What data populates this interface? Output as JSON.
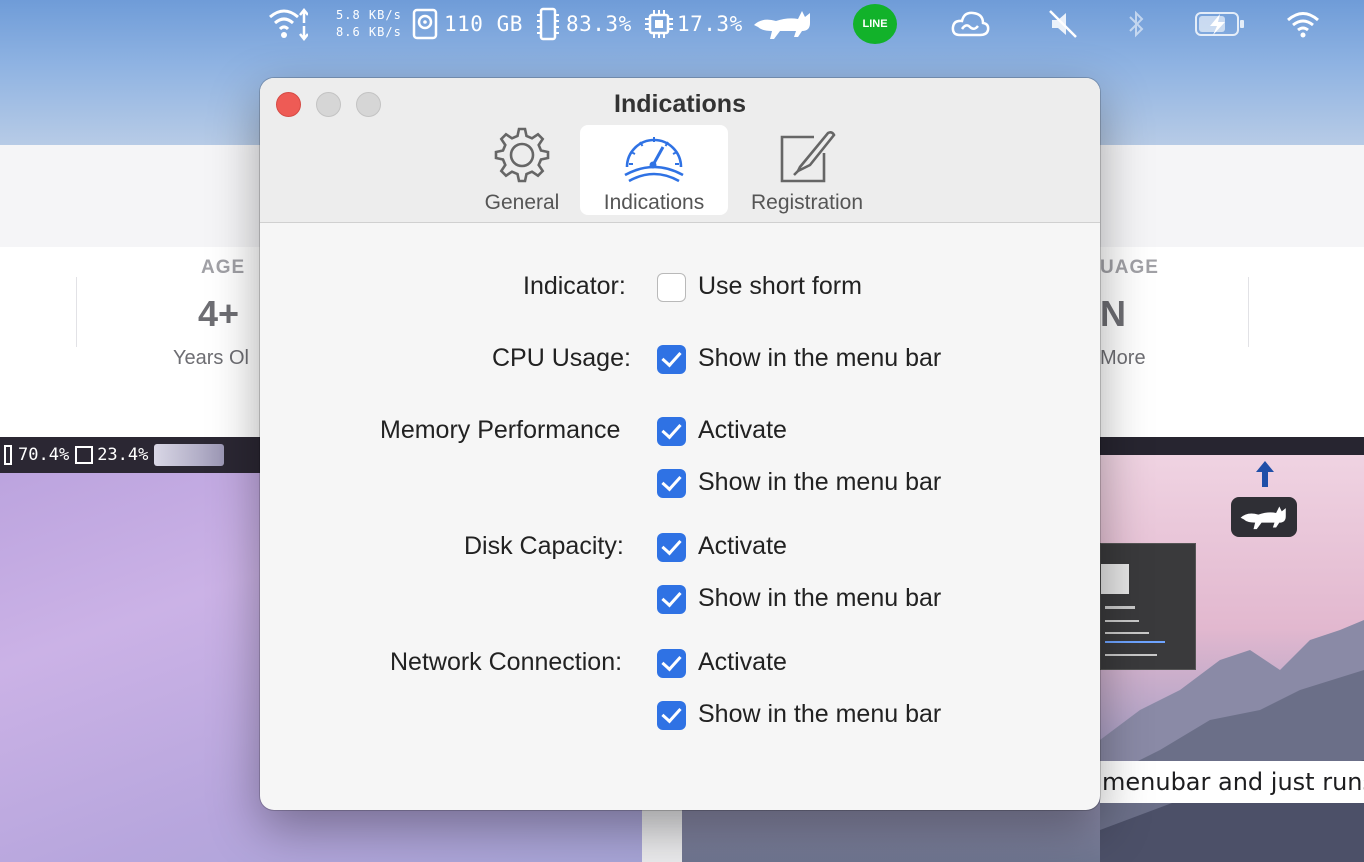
{
  "menubar": {
    "upload_speed": "5.8 KB/s",
    "download_speed": "8.6 KB/s",
    "disk": "110 GB",
    "memory": "83.3%",
    "cpu": "17.3%",
    "line_label": "LINE"
  },
  "store": {
    "age_label": "AGE",
    "age_value": "4+",
    "age_sub": "Years Ol",
    "language_label": "UAGE",
    "language_value": "N",
    "language_sub": "More"
  },
  "screenshot_left": {
    "memory": "70.4%",
    "cpu": "23.4%"
  },
  "screenshot_right": {
    "caption": "menubar and just runs"
  },
  "dialog": {
    "title": "Indications",
    "tabs": [
      {
        "label": "General",
        "icon": "gear-icon",
        "active": false
      },
      {
        "label": "Indications",
        "icon": "gauge-icon",
        "active": true
      },
      {
        "label": "Registration",
        "icon": "pen-on-paper-icon",
        "active": false
      }
    ],
    "rows": [
      {
        "label": "Indicator:",
        "option": "Use short form",
        "checked": false
      },
      {
        "label": "CPU Usage:",
        "option": "Show in the menu bar",
        "checked": true
      },
      {
        "label": "Memory Performance",
        "option": "Activate",
        "checked": true
      },
      {
        "label": "",
        "option": "Show in the menu bar",
        "checked": true
      },
      {
        "label": "Disk Capacity:",
        "option": "Activate",
        "checked": true
      },
      {
        "label": "",
        "option": "Show in the menu bar",
        "checked": true
      },
      {
        "label": "Network Connection:",
        "option": "Activate",
        "checked": true
      },
      {
        "label": "",
        "option": "Show in the menu bar",
        "checked": true
      }
    ]
  },
  "colors": {
    "checkbox_accent": "#2f72e4",
    "close_button": "#ee5b55",
    "active_tab_icon": "#2f72e4",
    "line_green": "#12b22a"
  }
}
